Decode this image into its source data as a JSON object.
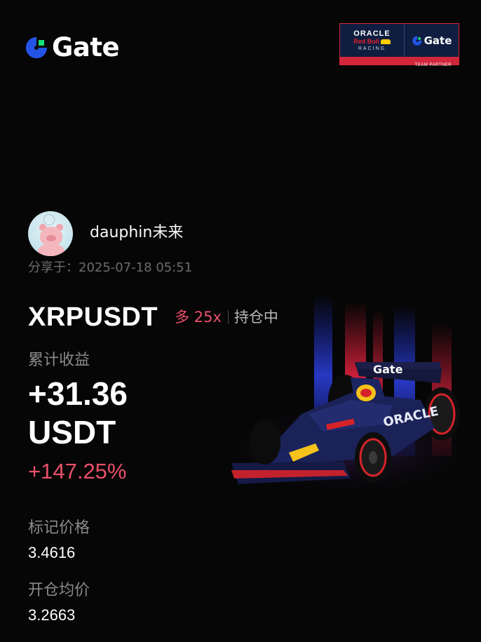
{
  "brand": {
    "name": "Gate",
    "accent_blue": "#2354e6",
    "accent_green": "#17e07b"
  },
  "partner": {
    "oracle": "ORACLE",
    "redbull": "Red Bull",
    "racing": "RACING",
    "gate": "Gate",
    "tagline": "TEAM PARTNER"
  },
  "user": {
    "name": "dauphin未来",
    "shared_label": "分享于：",
    "shared_time": "2025-07-18 05:51"
  },
  "position": {
    "symbol": "XRPUSDT",
    "side_leverage": "多 25x",
    "status": "持仓中",
    "pnl_label": "累计收益",
    "pnl_value": "+31.36",
    "pnl_unit": "USDT",
    "pnl_pct": "+147.25%",
    "mark_label": "标记价格",
    "mark_price": "3.4616",
    "entry_label": "开仓均价",
    "entry_price": "3.2663",
    "positive_color": "#e9506a"
  },
  "icons": [
    "gate-logo-icon",
    "red-bull-icon",
    "f1-car-illustration"
  ]
}
